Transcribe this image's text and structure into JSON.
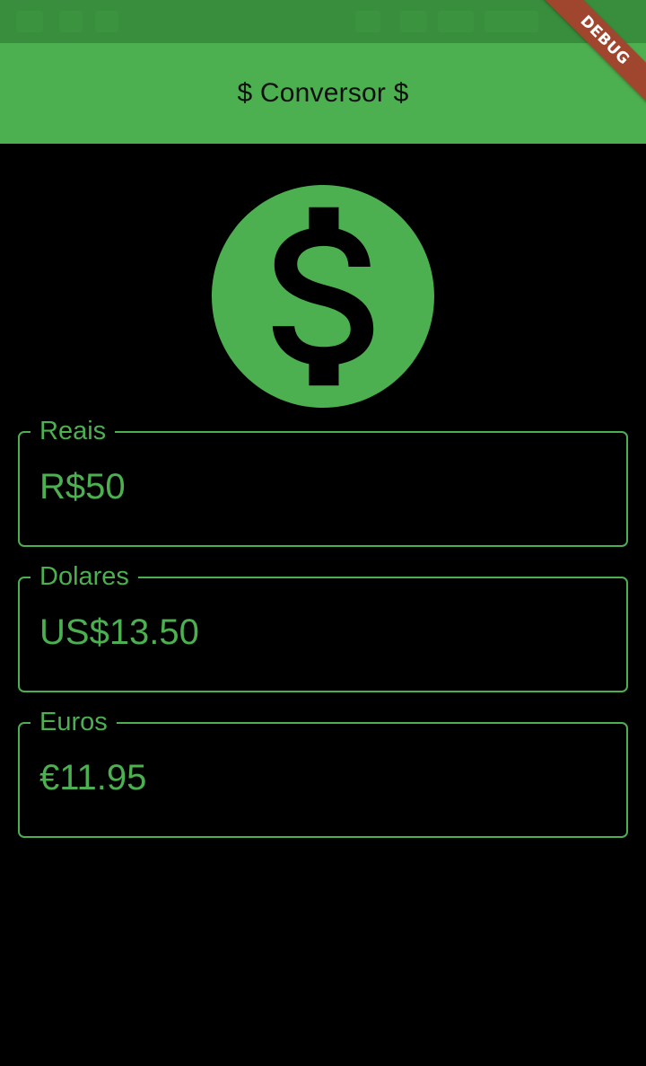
{
  "app_bar": {
    "title": "$ Conversor $"
  },
  "debug_banner": {
    "label": "DEBUG"
  },
  "icon": {
    "name": "monetization-on-icon"
  },
  "fields": [
    {
      "label": "Reais",
      "value": "R$50"
    },
    {
      "label": "Dolares",
      "value": "US$13.50"
    },
    {
      "label": "Euros",
      "value": "€11.95"
    }
  ],
  "colors": {
    "accent": "#4caf50",
    "status_bar": "#388e3c",
    "background": "#000000",
    "title_text": "#101010",
    "debug_ribbon": "#a0462e"
  }
}
